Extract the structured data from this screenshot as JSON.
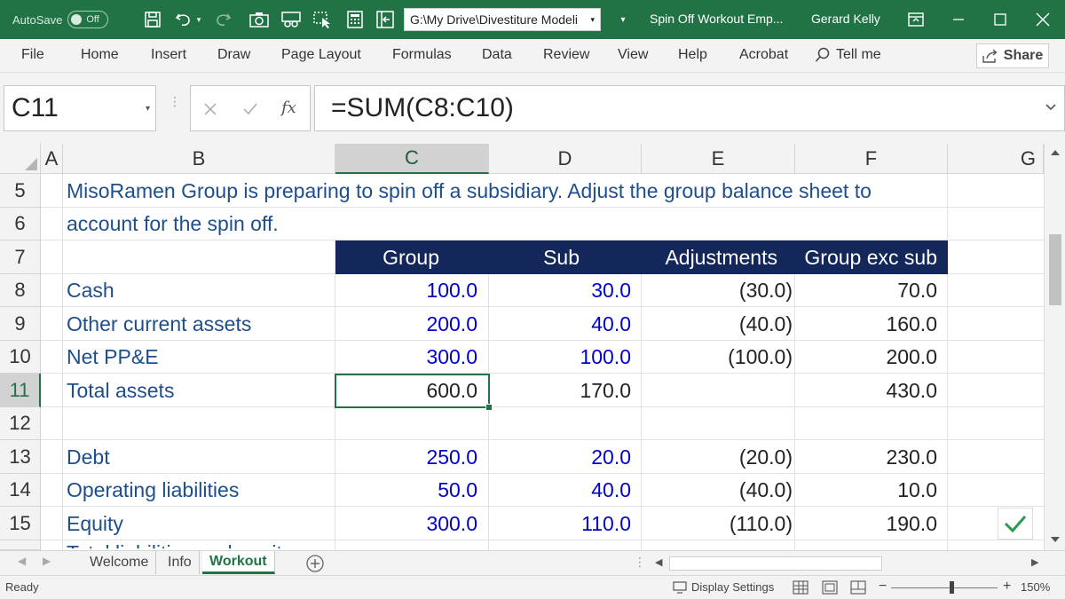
{
  "titlebar": {
    "autosave_label": "AutoSave",
    "autosave_state": "Off",
    "file_path": "G:\\My Drive\\Divestiture Modeli",
    "doc_title": "Spin Off Workout Emp...",
    "user_name": "Gerard Kelly"
  },
  "ribbon": {
    "tabs": [
      "File",
      "Home",
      "Insert",
      "Draw",
      "Page Layout",
      "Formulas",
      "Data",
      "Review",
      "View",
      "Help",
      "Acrobat"
    ],
    "tell_me": "Tell me",
    "share": "Share"
  },
  "formula_bar": {
    "name_box": "C11",
    "fx": "fx",
    "formula": "=SUM(C8:C10)"
  },
  "columns": [
    "A",
    "B",
    "C",
    "D",
    "E",
    "F",
    "G"
  ],
  "rows": [
    "5",
    "6",
    "7",
    "8",
    "9",
    "10",
    "11",
    "12",
    "13",
    "14",
    "15"
  ],
  "sheet": {
    "intro_line1": "MisoRamen Group is preparing to spin off a subsidiary. Adjust the group balance sheet to",
    "intro_line2": "account for the spin off.",
    "headers": [
      "Group",
      "Sub",
      "Adjustments",
      "Group exc sub"
    ],
    "lines": [
      {
        "label": "Cash",
        "group": "100.0",
        "sub": "30.0",
        "adj": "(30.0)",
        "exc": "70.0"
      },
      {
        "label": "Other current assets",
        "group": "200.0",
        "sub": "40.0",
        "adj": "(40.0)",
        "exc": "160.0"
      },
      {
        "label": "Net PP&E",
        "group": "300.0",
        "sub": "100.0",
        "adj": "(100.0)",
        "exc": "200.0"
      },
      {
        "label": "Total assets",
        "group": "600.0",
        "sub": "170.0",
        "adj": "",
        "exc": "430.0"
      },
      {
        "label": "",
        "group": "",
        "sub": "",
        "adj": "",
        "exc": ""
      },
      {
        "label": "Debt",
        "group": "250.0",
        "sub": "20.0",
        "adj": "(20.0)",
        "exc": "230.0"
      },
      {
        "label": "Operating liabilities",
        "group": "50.0",
        "sub": "40.0",
        "adj": "(40.0)",
        "exc": "10.0"
      },
      {
        "label": "Equity",
        "group": "300.0",
        "sub": "110.0",
        "adj": "(110.0)",
        "exc": "190.0"
      }
    ],
    "partial_next_row": "Total liabilities and equity"
  },
  "sheet_tabs": [
    "Welcome",
    "Info",
    "Workout"
  ],
  "active_sheet": "Workout",
  "statusbar": {
    "ready": "Ready",
    "display_settings": "Display Settings",
    "zoom": "150%"
  },
  "colors": {
    "excel_green": "#217346",
    "header_navy": "#13275a",
    "input_blue": "#0000cc",
    "label_blue": "#1f4e8c"
  }
}
